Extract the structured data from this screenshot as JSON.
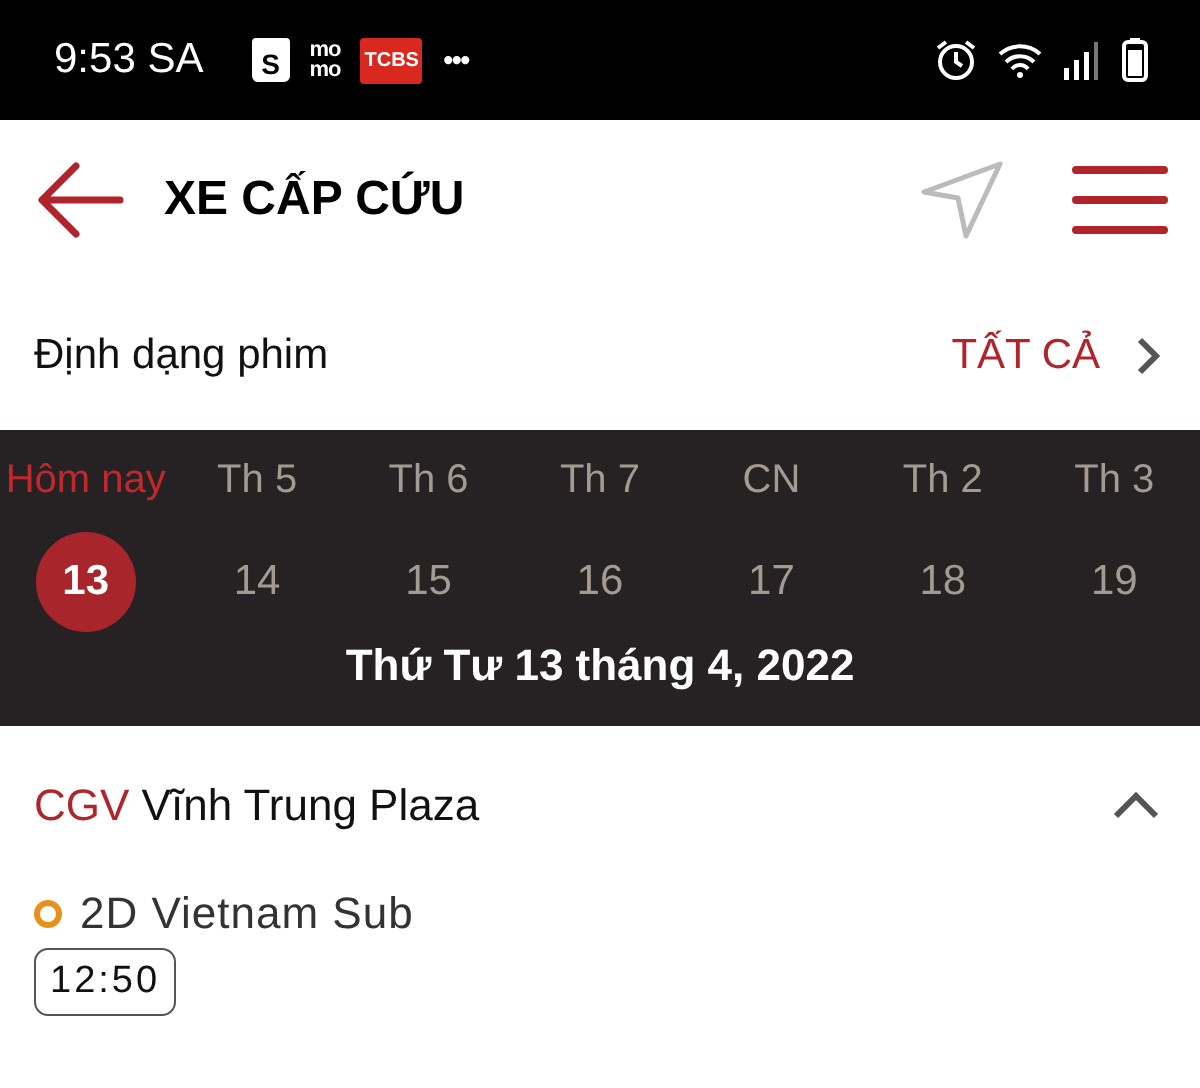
{
  "status_bar": {
    "time": "9:53 SA",
    "notifications": [
      {
        "kind": "bag",
        "text": "S"
      },
      {
        "kind": "stack",
        "lines": [
          "mo",
          "mo"
        ]
      },
      {
        "kind": "badge",
        "text": "TCBS"
      },
      {
        "kind": "dots",
        "text": "•••"
      }
    ]
  },
  "header": {
    "title": "XE CẤP CỨU"
  },
  "format_filter": {
    "label": "Định dạng phim",
    "value": "TẤT CẢ"
  },
  "days": [
    {
      "weekday": "Hôm nay",
      "date": "13",
      "selected": true
    },
    {
      "weekday": "Th 5",
      "date": "14",
      "selected": false
    },
    {
      "weekday": "Th 6",
      "date": "15",
      "selected": false
    },
    {
      "weekday": "Th 7",
      "date": "16",
      "selected": false
    },
    {
      "weekday": "CN",
      "date": "17",
      "selected": false
    },
    {
      "weekday": "Th 2",
      "date": "18",
      "selected": false
    },
    {
      "weekday": "Th 3",
      "date": "19",
      "selected": false
    }
  ],
  "selected_date": "Thứ Tư 13 tháng 4, 2022",
  "cinemas": [
    {
      "brand": "CGV",
      "name": "Vĩnh Trung Plaza",
      "expanded": true,
      "formats": [
        {
          "name": "2D Vietnam Sub",
          "color": "#e8901c",
          "times": [
            "12:50"
          ]
        }
      ]
    }
  ]
}
